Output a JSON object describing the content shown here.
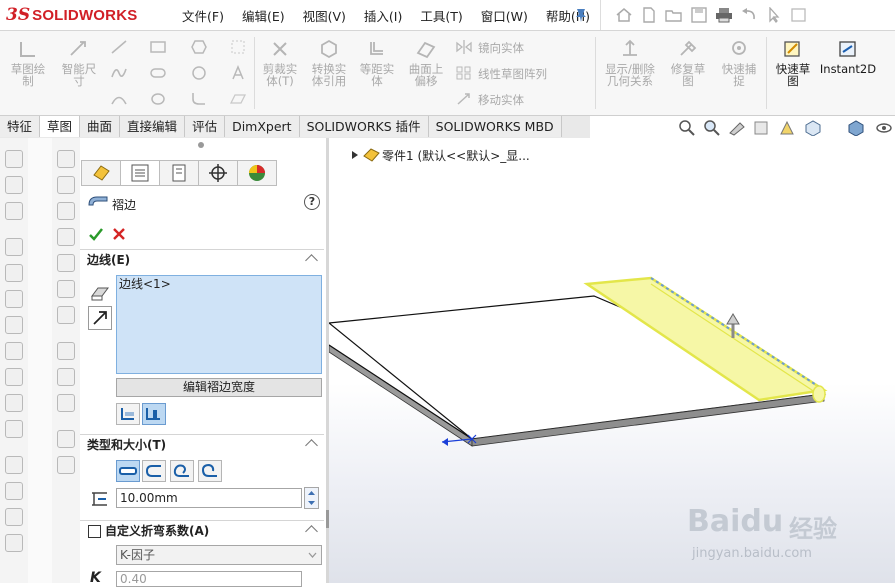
{
  "app": {
    "logo_ds": "3S",
    "logo_name": "SOLIDWORKS"
  },
  "menu": [
    "文件(F)",
    "编辑(E)",
    "视图(V)",
    "插入(I)",
    "工具(T)",
    "窗口(W)",
    "帮助(H)"
  ],
  "toolbar": {
    "sketch": "草图绘\n制",
    "smart_dim": "智能尺\n寸",
    "trim": "剪裁实\n体(T)",
    "convert": "转换实\n体引用",
    "offset_ent": "等距实\n体",
    "offset_surf": "曲面上\n偏移",
    "mirror": "镜向实体",
    "linear_pattern": "线性草图阵列",
    "move": "移动实体",
    "relations": "显示/删除\n几何关系",
    "repair": "修复草\n图",
    "snap": "快速捕\n捉",
    "quick_sketch": "快速草\n图",
    "instant2d": "Instant2D"
  },
  "tabs": [
    "特征",
    "草图",
    "曲面",
    "直接编辑",
    "评估",
    "DimXpert",
    "SOLIDWORKS 插件",
    "SOLIDWORKS MBD"
  ],
  "active_tab": "草图",
  "tree": {
    "root": "零件1  (默认<<默认>_显..."
  },
  "pm": {
    "title": "褶边",
    "help": "?",
    "section_edges": "边线(E)",
    "edge_item": "边线<1>",
    "edit_width": "编辑褶边宽度",
    "section_type": "类型和大小(T)",
    "length_value": "10.00mm",
    "section_bend": "自定义折弯系数(A)",
    "bend_type": "K-因子",
    "k_label": "K",
    "k_value": "0.40"
  },
  "watermark": {
    "brand": "Baidu",
    "cn": "经验",
    "url": "jingyan.baidu.com"
  },
  "colors": {
    "accent": "#d11f26",
    "highlight": "#f2f27a",
    "selection": "#cfe3f7"
  }
}
